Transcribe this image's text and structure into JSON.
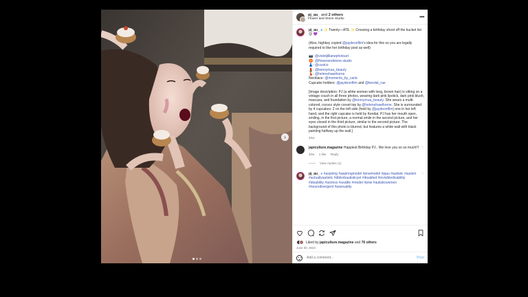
{
  "header": {
    "username": "pj_au_",
    "conjunction": "and",
    "others": "2 others",
    "subtitle": "Flower and Stone Studio",
    "more_icon": "more-horizontal-icon"
  },
  "photo": {
    "alt_icon": "photo-carousel",
    "next_icon": "chevron-right-icon",
    "slide_count": 3,
    "active_slide": 1
  },
  "caption": {
    "username": "pj_au_",
    "lines1": "✨ Twenty—ATE ✨ Crossing a birthday shoot off the bucket list 😊 💜",
    "p2_a": "(Also, highkey copied ",
    "p2_link": "@jaydeonfilm",
    "p2_b": "'s idea for this so you are legally required to like her birthday post as well)",
    "credits": [
      {
        "emoji": "📷: ",
        "handle": "@violetjillianephotoart"
      },
      {
        "emoji": "🏵️: ",
        "handle": "@flowerandstone.studio"
      },
      {
        "emoji": "👗: ",
        "handle": "@costco"
      },
      {
        "emoji": "💄: ",
        "handle": "@kennymua_beauty"
      },
      {
        "emoji": "💃: ",
        "handle": "@helenehawthorne"
      }
    ],
    "necklace_label": "Necklace: ",
    "necklace_handle": "@moments_by_carla",
    "cupcake_label": "Cupcake holders: ",
    "cupcake_handle1": "@jaydeonfilm",
    "cupcake_and": " and ",
    "cupcake_handle2": "@kendal_rae",
    "desc_a": "[Image description: PJ (a white woman with long, brown hair) is sitting on a vintage couch in all three photos, wearing dark pink lipstick, dark pink blush, mascara, and foundation by ",
    "desc_link1": "@kennymua_beauty",
    "desc_b": ". She wears a multi-colored, rococo style corset top by ",
    "desc_link2": "@helenehawthorne",
    "desc_c": ". She is surrounded by 4 cupcakes: 2 on the left side (held by ",
    "desc_link3": "@jaydeonfilm",
    "desc_d": ") one in her left hand, and the right cupcake is held by Kendal. PJ has her mouth open, smiling, in the first picture, a normal smile in the second picture, and her eyes closed in the third picture, similar to the second picture. The background of this photo is blurred, but features a white wall with black painting halfway up the wall.]",
    "age": "40w"
  },
  "comment1": {
    "username": "japiculture.magazine",
    "text": "Happiest Birthday PJ.. We love you so so much!!!",
    "age": "40w",
    "likes": "1 like",
    "reply": "Reply",
    "view_replies": "View replies (1)"
  },
  "comment2": {
    "username": "pj_au_",
    "tags": "#aspiring #aspiringmodel #pnwmodel #pjau #autistic #autism #actuallyautistic #dblisrbautisticyet #disabled #invisibledisability #disability #actress #seattle #model #pnw #autisticwomen #neurodivergent #asexuality"
  },
  "actions": {
    "liked_by": "Liked by",
    "liked_user": "japiculture.magazine",
    "liked_and": "and",
    "liked_others": "76 others",
    "date": "June 30, 2023"
  },
  "add_comment": {
    "placeholder": "Add a comment...",
    "post_label": "Post"
  },
  "colors": {
    "link": "#3a55b4",
    "post_button": "#8fc3f5",
    "backdrop": "#000000"
  }
}
